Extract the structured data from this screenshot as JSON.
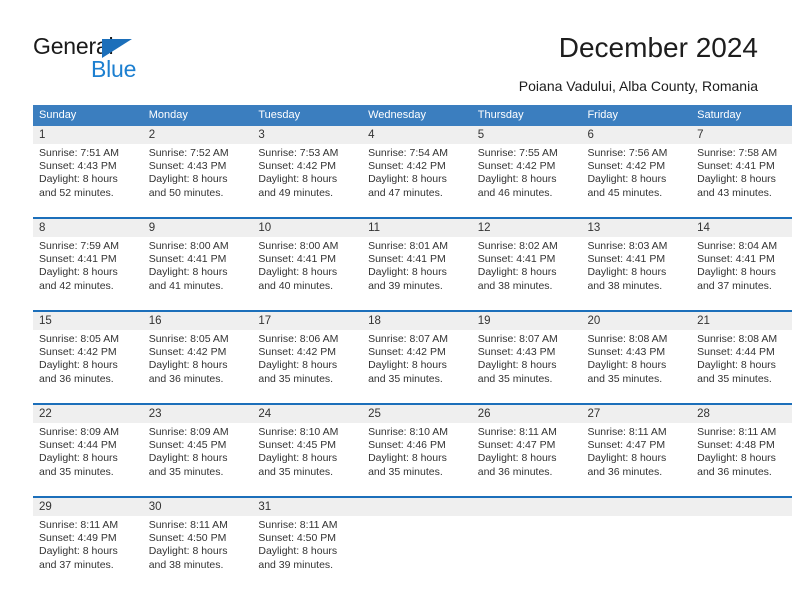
{
  "logo": {
    "word_one": "General",
    "word_two": "Blue",
    "triangle_icon": "blue-triangle-icon",
    "accent_color": "#1c7fd0"
  },
  "header": {
    "title": "December 2024",
    "subtitle": "Poiana Vadului, Alba County, Romania"
  },
  "calendar": {
    "header_bg": "#3b7ebf",
    "daynum_bg": "#efefef",
    "rule_color": "#1c6fba",
    "weekday_headers": [
      "Sunday",
      "Monday",
      "Tuesday",
      "Wednesday",
      "Thursday",
      "Friday",
      "Saturday"
    ],
    "weeks": [
      [
        {
          "day": "1",
          "sunrise": "Sunrise: 7:51 AM",
          "sunset": "Sunset: 4:43 PM",
          "daylight_1": "Daylight: 8 hours",
          "daylight_2": "and 52 minutes."
        },
        {
          "day": "2",
          "sunrise": "Sunrise: 7:52 AM",
          "sunset": "Sunset: 4:43 PM",
          "daylight_1": "Daylight: 8 hours",
          "daylight_2": "and 50 minutes."
        },
        {
          "day": "3",
          "sunrise": "Sunrise: 7:53 AM",
          "sunset": "Sunset: 4:42 PM",
          "daylight_1": "Daylight: 8 hours",
          "daylight_2": "and 49 minutes."
        },
        {
          "day": "4",
          "sunrise": "Sunrise: 7:54 AM",
          "sunset": "Sunset: 4:42 PM",
          "daylight_1": "Daylight: 8 hours",
          "daylight_2": "and 47 minutes."
        },
        {
          "day": "5",
          "sunrise": "Sunrise: 7:55 AM",
          "sunset": "Sunset: 4:42 PM",
          "daylight_1": "Daylight: 8 hours",
          "daylight_2": "and 46 minutes."
        },
        {
          "day": "6",
          "sunrise": "Sunrise: 7:56 AM",
          "sunset": "Sunset: 4:42 PM",
          "daylight_1": "Daylight: 8 hours",
          "daylight_2": "and 45 minutes."
        },
        {
          "day": "7",
          "sunrise": "Sunrise: 7:58 AM",
          "sunset": "Sunset: 4:41 PM",
          "daylight_1": "Daylight: 8 hours",
          "daylight_2": "and 43 minutes."
        }
      ],
      [
        {
          "day": "8",
          "sunrise": "Sunrise: 7:59 AM",
          "sunset": "Sunset: 4:41 PM",
          "daylight_1": "Daylight: 8 hours",
          "daylight_2": "and 42 minutes."
        },
        {
          "day": "9",
          "sunrise": "Sunrise: 8:00 AM",
          "sunset": "Sunset: 4:41 PM",
          "daylight_1": "Daylight: 8 hours",
          "daylight_2": "and 41 minutes."
        },
        {
          "day": "10",
          "sunrise": "Sunrise: 8:00 AM",
          "sunset": "Sunset: 4:41 PM",
          "daylight_1": "Daylight: 8 hours",
          "daylight_2": "and 40 minutes."
        },
        {
          "day": "11",
          "sunrise": "Sunrise: 8:01 AM",
          "sunset": "Sunset: 4:41 PM",
          "daylight_1": "Daylight: 8 hours",
          "daylight_2": "and 39 minutes."
        },
        {
          "day": "12",
          "sunrise": "Sunrise: 8:02 AM",
          "sunset": "Sunset: 4:41 PM",
          "daylight_1": "Daylight: 8 hours",
          "daylight_2": "and 38 minutes."
        },
        {
          "day": "13",
          "sunrise": "Sunrise: 8:03 AM",
          "sunset": "Sunset: 4:41 PM",
          "daylight_1": "Daylight: 8 hours",
          "daylight_2": "and 38 minutes."
        },
        {
          "day": "14",
          "sunrise": "Sunrise: 8:04 AM",
          "sunset": "Sunset: 4:41 PM",
          "daylight_1": "Daylight: 8 hours",
          "daylight_2": "and 37 minutes."
        }
      ],
      [
        {
          "day": "15",
          "sunrise": "Sunrise: 8:05 AM",
          "sunset": "Sunset: 4:42 PM",
          "daylight_1": "Daylight: 8 hours",
          "daylight_2": "and 36 minutes."
        },
        {
          "day": "16",
          "sunrise": "Sunrise: 8:05 AM",
          "sunset": "Sunset: 4:42 PM",
          "daylight_1": "Daylight: 8 hours",
          "daylight_2": "and 36 minutes."
        },
        {
          "day": "17",
          "sunrise": "Sunrise: 8:06 AM",
          "sunset": "Sunset: 4:42 PM",
          "daylight_1": "Daylight: 8 hours",
          "daylight_2": "and 35 minutes."
        },
        {
          "day": "18",
          "sunrise": "Sunrise: 8:07 AM",
          "sunset": "Sunset: 4:42 PM",
          "daylight_1": "Daylight: 8 hours",
          "daylight_2": "and 35 minutes."
        },
        {
          "day": "19",
          "sunrise": "Sunrise: 8:07 AM",
          "sunset": "Sunset: 4:43 PM",
          "daylight_1": "Daylight: 8 hours",
          "daylight_2": "and 35 minutes."
        },
        {
          "day": "20",
          "sunrise": "Sunrise: 8:08 AM",
          "sunset": "Sunset: 4:43 PM",
          "daylight_1": "Daylight: 8 hours",
          "daylight_2": "and 35 minutes."
        },
        {
          "day": "21",
          "sunrise": "Sunrise: 8:08 AM",
          "sunset": "Sunset: 4:44 PM",
          "daylight_1": "Daylight: 8 hours",
          "daylight_2": "and 35 minutes."
        }
      ],
      [
        {
          "day": "22",
          "sunrise": "Sunrise: 8:09 AM",
          "sunset": "Sunset: 4:44 PM",
          "daylight_1": "Daylight: 8 hours",
          "daylight_2": "and 35 minutes."
        },
        {
          "day": "23",
          "sunrise": "Sunrise: 8:09 AM",
          "sunset": "Sunset: 4:45 PM",
          "daylight_1": "Daylight: 8 hours",
          "daylight_2": "and 35 minutes."
        },
        {
          "day": "24",
          "sunrise": "Sunrise: 8:10 AM",
          "sunset": "Sunset: 4:45 PM",
          "daylight_1": "Daylight: 8 hours",
          "daylight_2": "and 35 minutes."
        },
        {
          "day": "25",
          "sunrise": "Sunrise: 8:10 AM",
          "sunset": "Sunset: 4:46 PM",
          "daylight_1": "Daylight: 8 hours",
          "daylight_2": "and 35 minutes."
        },
        {
          "day": "26",
          "sunrise": "Sunrise: 8:11 AM",
          "sunset": "Sunset: 4:47 PM",
          "daylight_1": "Daylight: 8 hours",
          "daylight_2": "and 36 minutes."
        },
        {
          "day": "27",
          "sunrise": "Sunrise: 8:11 AM",
          "sunset": "Sunset: 4:47 PM",
          "daylight_1": "Daylight: 8 hours",
          "daylight_2": "and 36 minutes."
        },
        {
          "day": "28",
          "sunrise": "Sunrise: 8:11 AM",
          "sunset": "Sunset: 4:48 PM",
          "daylight_1": "Daylight: 8 hours",
          "daylight_2": "and 36 minutes."
        }
      ],
      [
        {
          "day": "29",
          "sunrise": "Sunrise: 8:11 AM",
          "sunset": "Sunset: 4:49 PM",
          "daylight_1": "Daylight: 8 hours",
          "daylight_2": "and 37 minutes."
        },
        {
          "day": "30",
          "sunrise": "Sunrise: 8:11 AM",
          "sunset": "Sunset: 4:50 PM",
          "daylight_1": "Daylight: 8 hours",
          "daylight_2": "and 38 minutes."
        },
        {
          "day": "31",
          "sunrise": "Sunrise: 8:11 AM",
          "sunset": "Sunset: 4:50 PM",
          "daylight_1": "Daylight: 8 hours",
          "daylight_2": "and 39 minutes."
        },
        {
          "day": "",
          "sunrise": "",
          "sunset": "",
          "daylight_1": "",
          "daylight_2": ""
        },
        {
          "day": "",
          "sunrise": "",
          "sunset": "",
          "daylight_1": "",
          "daylight_2": ""
        },
        {
          "day": "",
          "sunrise": "",
          "sunset": "",
          "daylight_1": "",
          "daylight_2": ""
        },
        {
          "day": "",
          "sunrise": "",
          "sunset": "",
          "daylight_1": "",
          "daylight_2": ""
        }
      ]
    ]
  }
}
